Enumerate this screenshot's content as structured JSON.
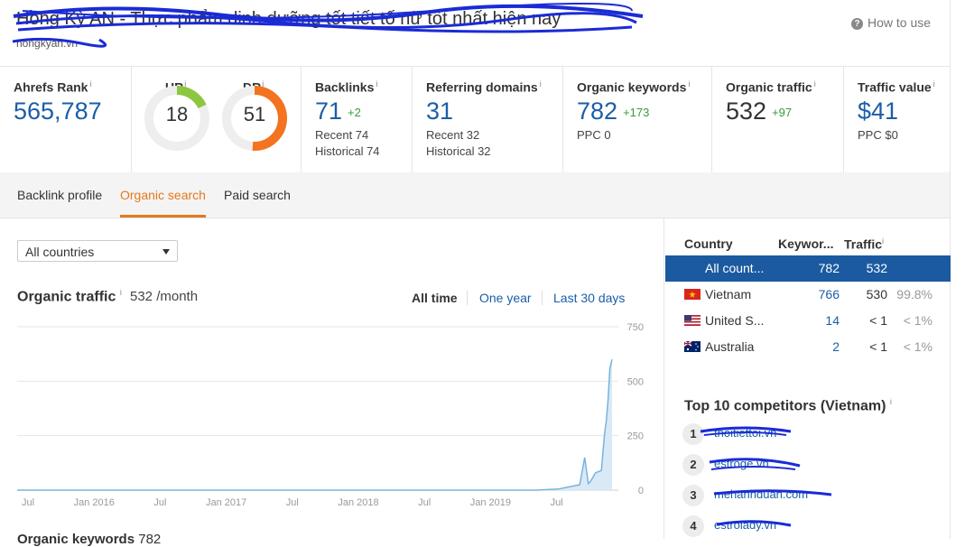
{
  "header": {
    "title": "Hồng Kỳ AN - Thực phẩm dinh dưỡng tốt tiết tố nữ tốt nhất hiện nay",
    "subtitle": "hongkyan.vn",
    "how_to_use": "How to use"
  },
  "metrics": {
    "ahrefs_rank": {
      "label": "Ahrefs Rank",
      "info": "i",
      "value": "565,787"
    },
    "ur": {
      "label": "UR",
      "info": "i",
      "value": "18",
      "level": 18,
      "color": "#8ec63f"
    },
    "dr": {
      "label": "DR",
      "info": "i",
      "value": "51",
      "level": 51,
      "color": "#f37321"
    },
    "backlinks": {
      "label": "Backlinks",
      "info": "i",
      "value": "71",
      "delta": "+2",
      "recent": "Recent 74",
      "historical": "Historical 74"
    },
    "referring_domains": {
      "label": "Referring domains",
      "info": "i",
      "value": "31",
      "recent": "Recent 32",
      "historical": "Historical 32"
    },
    "organic_keywords": {
      "label": "Organic keywords",
      "info": "i",
      "value": "782",
      "delta": "+173",
      "sub": "PPC 0"
    },
    "organic_traffic": {
      "label": "Organic traffic",
      "info": "i",
      "value": "532",
      "delta": "+97"
    },
    "traffic_value": {
      "label": "Traffic value",
      "info": "i",
      "value": "$41",
      "sub": "PPC $0"
    }
  },
  "tabs": {
    "backlink_profile": "Backlink profile",
    "organic_search": "Organic search",
    "paid_search": "Paid search"
  },
  "filter": {
    "country": "All countries"
  },
  "organic_traffic_section": {
    "title": "Organic traffic",
    "info": "i",
    "value": "532 /month",
    "ranges": [
      "All time",
      "One year",
      "Last 30 days"
    ],
    "active_range": "All time"
  },
  "chart_data": {
    "type": "area",
    "xlabel": "",
    "ylabel": "",
    "ylim": [
      0,
      750
    ],
    "yticks": [
      "750",
      "500",
      "250",
      "0"
    ],
    "xticks": [
      "Jul",
      "Jan 2016",
      "Jul",
      "Jan 2017",
      "Jul",
      "Jan 2018",
      "Jul",
      "Jan 2019",
      "Jul"
    ],
    "x": [
      "2015-06",
      "2019-06",
      "2019-08",
      "2019-09",
      "2019-10",
      "2019-10-15",
      "2019-10-25",
      "2019-11",
      "2019-11-15",
      "2019-12",
      "2019-12-10",
      "2019-12-15",
      "2019-12-20",
      "2019-12-25",
      "2019-12-31"
    ],
    "values": [
      0,
      0,
      5,
      15,
      25,
      150,
      30,
      40,
      80,
      90,
      260,
      320,
      420,
      560,
      600
    ],
    "color": "#7ab3dd",
    "grid": true
  },
  "country_table": {
    "headers": {
      "country": "Country",
      "keywords": "Keywor...",
      "traffic": "Traffic",
      "info": "i"
    },
    "rows": [
      {
        "flag": "none",
        "name": "All count...",
        "keywords": "782",
        "traffic": "532",
        "share": ""
      },
      {
        "flag": "vn",
        "name": "Vietnam",
        "keywords": "766",
        "traffic": "530",
        "share": "99.8%"
      },
      {
        "flag": "us",
        "name": "United S...",
        "keywords": "14",
        "traffic": "< 1",
        "share": "< 1%"
      },
      {
        "flag": "au",
        "name": "Australia",
        "keywords": "2",
        "traffic": "< 1",
        "share": "< 1%"
      }
    ]
  },
  "competitors": {
    "title": "Top 10 competitors (Vietnam)",
    "info": "i",
    "items": [
      {
        "rank": "1",
        "name": "thoitiettoi.vn"
      },
      {
        "rank": "2",
        "name": "estroge.vn"
      },
      {
        "rank": "3",
        "name": "mehanhduan.com"
      },
      {
        "rank": "4",
        "name": "estrolady.vn"
      }
    ]
  },
  "next_section": {
    "title": "Organic keywords",
    "value": "782"
  },
  "colors": {
    "accent": "#e5781a",
    "link": "#1a5ea8",
    "selected_row": "#1b5aa0",
    "positive": "#3a9c3a"
  }
}
